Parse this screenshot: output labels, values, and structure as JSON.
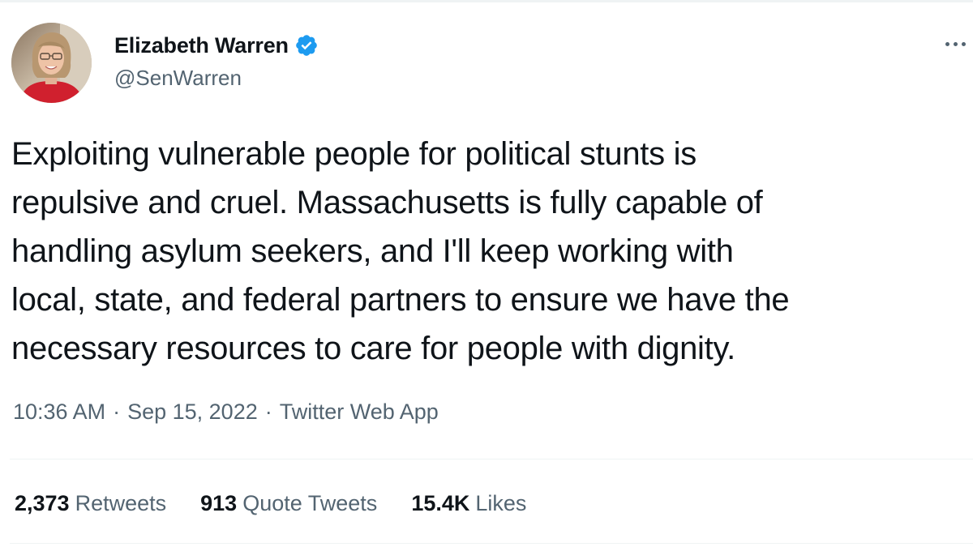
{
  "author": {
    "display_name": "Elizabeth Warren",
    "handle": "@SenWarren",
    "verified": true,
    "avatar_icon": "profile-photo"
  },
  "tweet": {
    "text": "Exploiting vulnerable people for political stunts is\nrepulsive and cruel. Massachusetts is fully capable of\nhandling asylum seekers, and I'll keep working with\nlocal, state, and federal partners to ensure we have the\nnecessary resources to care for people with dignity.",
    "time": "10:36 AM",
    "separator": "·",
    "date": "Sep 15, 2022",
    "source": "Twitter Web App"
  },
  "stats": {
    "retweets": {
      "count": "2,373",
      "label": "Retweets"
    },
    "quote_tweets": {
      "count": "913",
      "label": "Quote Tweets"
    },
    "likes": {
      "count": "15.4K",
      "label": "Likes"
    }
  },
  "icons": {
    "verified": "verified-badge-icon",
    "more": "more-options-icon"
  },
  "colors": {
    "text_primary": "#0f1419",
    "text_secondary": "#536471",
    "verified_blue": "#1d9bf0",
    "divider": "#eff3f4"
  }
}
